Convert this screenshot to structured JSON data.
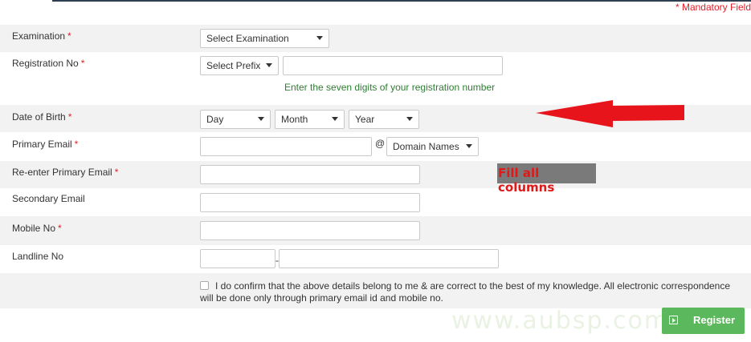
{
  "mandatory_note": "* Mandatory Field",
  "form": {
    "examination": {
      "label": "Examination",
      "req": "*",
      "select": "Select Examination"
    },
    "registration": {
      "label": "Registration No",
      "req": "*",
      "prefix": "Select Prefix",
      "value": "",
      "hint": "Enter the seven digits of your registration number"
    },
    "dob": {
      "label": "Date of Birth",
      "req": "*",
      "day": "Day",
      "month": "Month",
      "year": "Year"
    },
    "primary_email": {
      "label": "Primary Email",
      "req": "*",
      "value": "",
      "at": "@",
      "domain": "Domain Names"
    },
    "reenter_email": {
      "label": "Re-enter Primary Email",
      "req": "*",
      "value": ""
    },
    "secondary_email": {
      "label": "Secondary Email",
      "value": ""
    },
    "mobile": {
      "label": "Mobile No",
      "req": "*",
      "value": ""
    },
    "landline": {
      "label": "Landline No",
      "code": "",
      "number": "",
      "dash": "-"
    },
    "confirm": {
      "checked": false,
      "text": "I do confirm that the above details belong to me & are correct to the best of my knowledge. All electronic correspondence will be done only through primary email id and mobile no."
    }
  },
  "annotation": {
    "text": "Fill all columns",
    "arrow_color": "#e8141c"
  },
  "watermark": "www.aubsp.com",
  "register_label": "Register",
  "colors": {
    "required": "#e0202a",
    "hint": "#2e7d32",
    "button": "#5cb85c",
    "row_shade": "#f2f2f2"
  }
}
